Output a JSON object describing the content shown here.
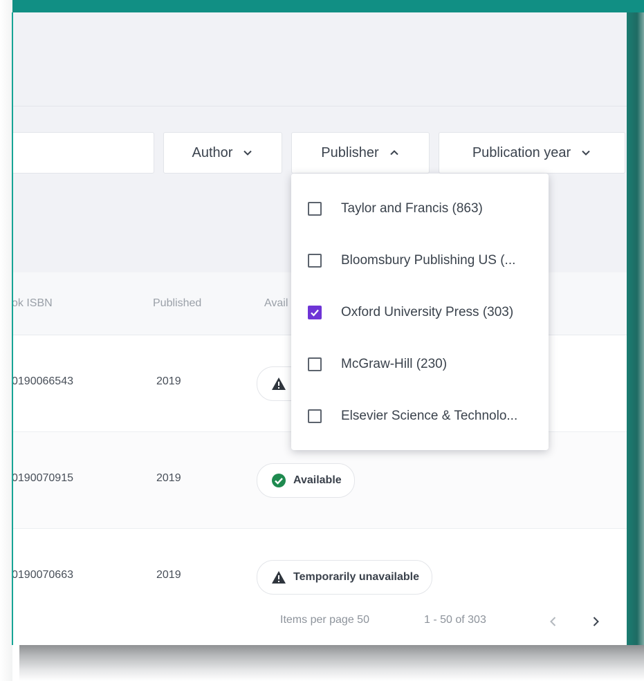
{
  "filters": {
    "search_placeholder": "",
    "author_label": "Author",
    "publisher_label": "Publisher",
    "year_label": "Publication year"
  },
  "publisher_dropdown": {
    "options": [
      {
        "label": "Taylor and Francis (863)",
        "checked": false
      },
      {
        "label": "Bloomsbury Publishing US (...",
        "checked": false
      },
      {
        "label": "Oxford University Press (303)",
        "checked": true
      },
      {
        "label": "McGraw-Hill (230)",
        "checked": false
      },
      {
        "label": "Elsevier Science & Technolo...",
        "checked": false
      }
    ]
  },
  "table": {
    "columns": {
      "isbn": "ok ISBN",
      "published": "Published",
      "availability": "Avail"
    },
    "rows": [
      {
        "isbn": "0190066543",
        "published": "2019",
        "status": "",
        "status_icon": "warning-icon"
      },
      {
        "isbn": "0190070915",
        "published": "2019",
        "status": "Available",
        "status_icon": "check-circle-icon"
      },
      {
        "isbn": "0190070663",
        "published": "2019",
        "status": "Temporarily unavailable",
        "status_icon": "warning-icon"
      }
    ]
  },
  "footer": {
    "items_per_page": "Items per page 50",
    "range": "1 - 50 of 303"
  },
  "colors": {
    "accent": "#6e34d6",
    "available": "#1e8a4f",
    "frame": "#118f84"
  }
}
